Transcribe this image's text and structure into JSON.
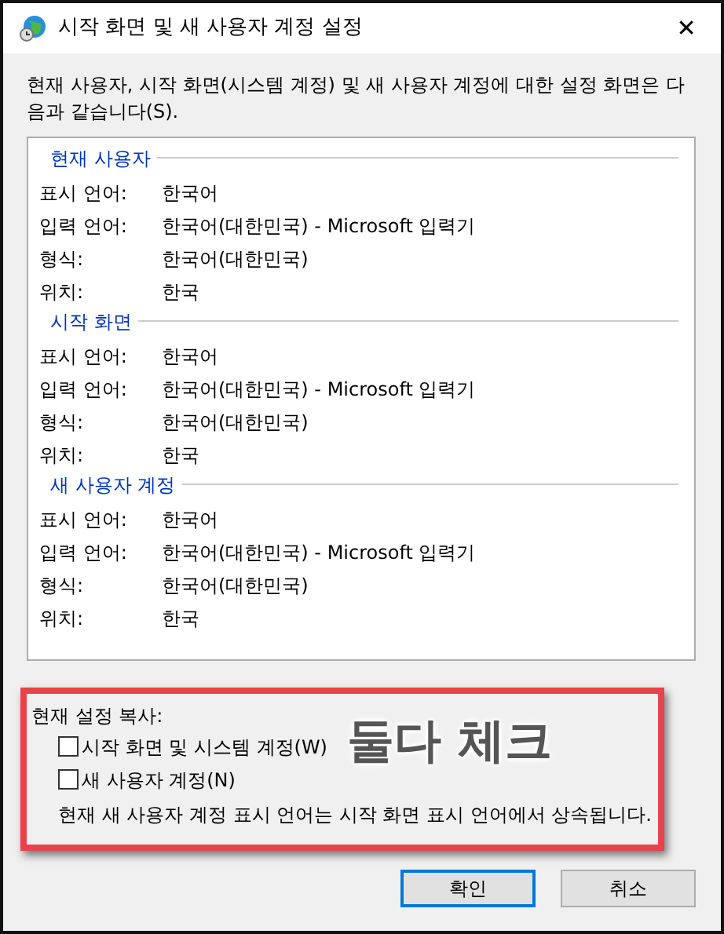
{
  "window": {
    "title": "시작 화면 및 새 사용자 계정 설정",
    "close": "✕"
  },
  "intro": "현재 사용자, 시작 화면(시스템 계정) 및 새 사용자 계정에 대한 설정 화면은 다음과 같습니다(S).",
  "sections": [
    {
      "title": "현재 사용자",
      "rows": [
        {
          "label": "표시 언어:",
          "value": "한국어"
        },
        {
          "label": "입력 언어:",
          "value": "한국어(대한민국) - Microsoft 입력기"
        },
        {
          "label": "형식:",
          "value": "한국어(대한민국)"
        },
        {
          "label": "위치:",
          "value": "한국"
        }
      ]
    },
    {
      "title": "시작 화면",
      "rows": [
        {
          "label": "표시 언어:",
          "value": "한국어"
        },
        {
          "label": "입력 언어:",
          "value": "한국어(대한민국) - Microsoft 입력기"
        },
        {
          "label": "형식:",
          "value": "한국어(대한민국)"
        },
        {
          "label": "위치:",
          "value": "한국"
        }
      ]
    },
    {
      "title": "새 사용자 계정",
      "rows": [
        {
          "label": "표시 언어:",
          "value": "한국어"
        },
        {
          "label": "입력 언어:",
          "value": "한국어(대한민국) - Microsoft 입력기"
        },
        {
          "label": "형식:",
          "value": "한국어(대한민국)"
        },
        {
          "label": "위치:",
          "value": "한국"
        }
      ]
    }
  ],
  "copy": {
    "title": "현재 설정 복사:",
    "options": [
      {
        "label": "시작 화면 및 시스템 계정(W)",
        "checked": false
      },
      {
        "label": "새 사용자 계정(N)",
        "checked": false
      }
    ],
    "note": "현재 새 사용자 계정 표시 언어는 시작 화면 표시 언어에서 상속됩니다."
  },
  "annotation": {
    "text": "둘다 체크"
  },
  "buttons": [
    {
      "label": "확인",
      "default": true
    },
    {
      "label": "취소",
      "default": false
    }
  ]
}
